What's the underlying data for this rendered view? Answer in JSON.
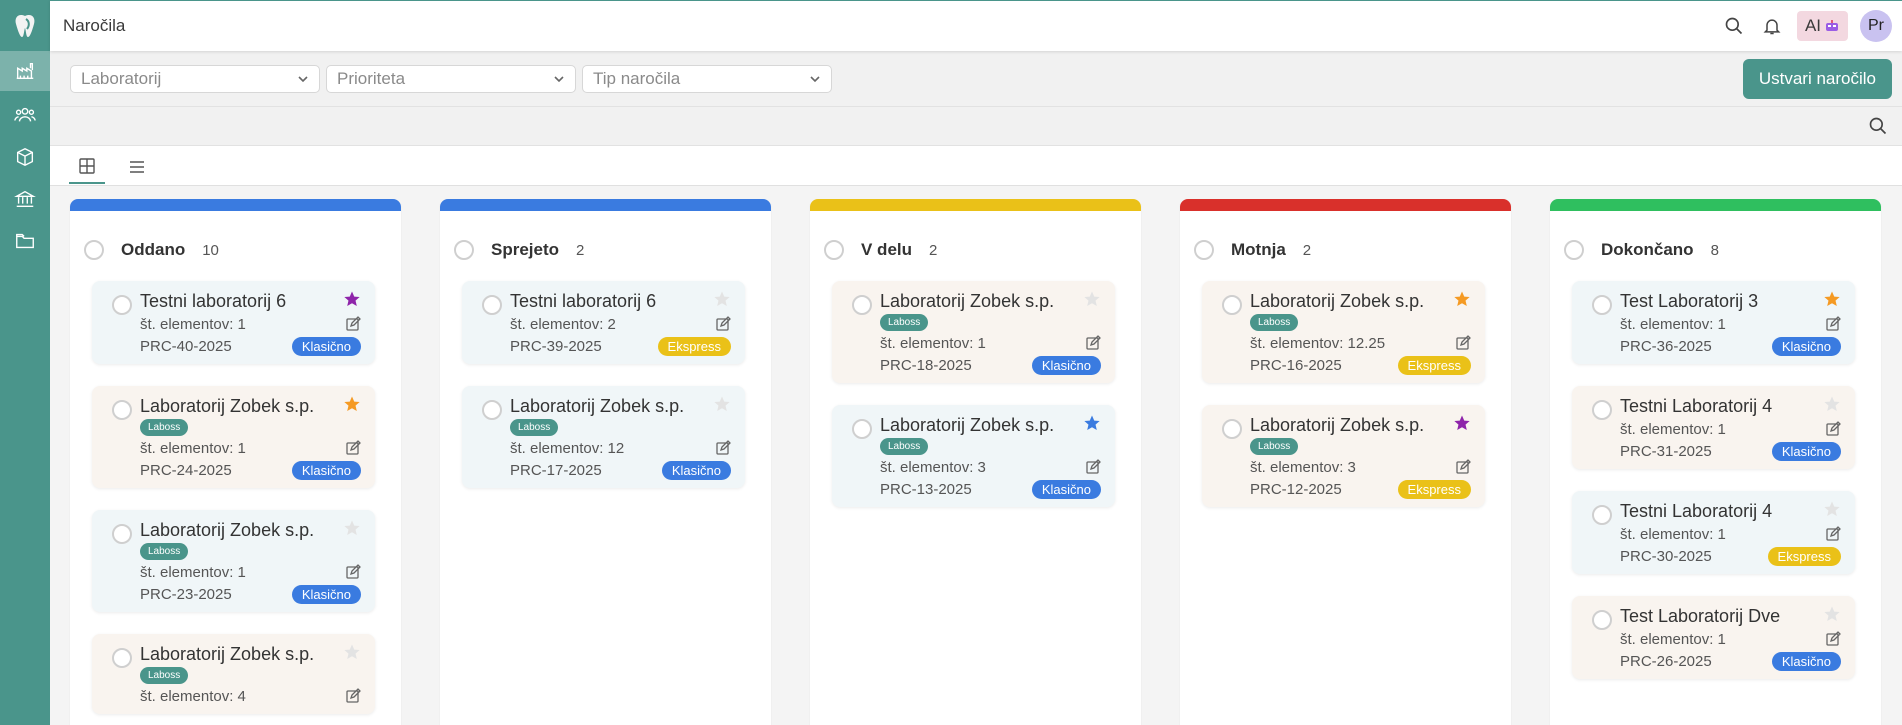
{
  "app": {
    "page_title": "Naročila",
    "ai_label": "AI",
    "avatar_initials": "Pr"
  },
  "filters": {
    "laboratory": "Laboratorij",
    "priority": "Prioriteta",
    "order_type": "Tip naročila",
    "create_label": "Ustvari naročilo"
  },
  "colors": {
    "accent": "#4a958b",
    "klasicno": "#3a7be0",
    "ekspress": "#eac118"
  },
  "columns": [
    {
      "title": "Oddano",
      "count": "10",
      "color": "#3a7be0",
      "cards": [
        {
          "title": "Testni laboratorij 6",
          "tag": "",
          "elements": "št. elementov: 1",
          "code": "PRC-40-2025",
          "type": "Klasično",
          "star": "purple",
          "bg": "blue"
        },
        {
          "title": "Laboratorij Zobek s.p.",
          "tag": "Laboss",
          "elements": "št. elementov: 1",
          "code": "PRC-24-2025",
          "type": "Klasično",
          "star": "orange",
          "bg": "beige"
        },
        {
          "title": "Laboratorij Zobek s.p.",
          "tag": "Laboss",
          "elements": "št. elementov: 1",
          "code": "PRC-23-2025",
          "type": "Klasično",
          "star": "grey",
          "bg": "blue"
        },
        {
          "title": "Laboratorij Zobek s.p.",
          "tag": "Laboss",
          "elements": "št. elementov: 4",
          "code": "",
          "type": "",
          "star": "grey",
          "bg": "beige"
        }
      ]
    },
    {
      "title": "Sprejeto",
      "count": "2",
      "color": "#3a7be0",
      "cards": [
        {
          "title": "Testni laboratorij 6",
          "tag": "",
          "elements": "št. elementov: 2",
          "code": "PRC-39-2025",
          "type": "Ekspress",
          "star": "grey",
          "bg": "blue"
        },
        {
          "title": "Laboratorij Zobek s.p.",
          "tag": "Laboss",
          "elements": "št. elementov: 12",
          "code": "PRC-17-2025",
          "type": "Klasično",
          "star": "grey",
          "bg": "blue"
        }
      ]
    },
    {
      "title": "V delu",
      "count": "2",
      "color": "#eac118",
      "cards": [
        {
          "title": "Laboratorij Zobek s.p.",
          "tag": "Laboss",
          "elements": "št. elementov: 1",
          "code": "PRC-18-2025",
          "type": "Klasično",
          "star": "grey",
          "bg": "beige"
        },
        {
          "title": "Laboratorij Zobek s.p.",
          "tag": "Laboss",
          "elements": "št. elementov: 3",
          "code": "PRC-13-2025",
          "type": "Klasično",
          "star": "blue",
          "bg": "blue"
        }
      ]
    },
    {
      "title": "Motnja",
      "count": "2",
      "color": "#d9302b",
      "cards": [
        {
          "title": "Laboratorij Zobek s.p.",
          "tag": "Laboss",
          "elements": "št. elementov: 12.25",
          "code": "PRC-16-2025",
          "type": "Ekspress",
          "star": "orange",
          "bg": "beige"
        },
        {
          "title": "Laboratorij Zobek s.p.",
          "tag": "Laboss",
          "elements": "št. elementov: 3",
          "code": "PRC-12-2025",
          "type": "Ekspress",
          "star": "purple",
          "bg": "beige"
        }
      ]
    },
    {
      "title": "Dokončano",
      "count": "8",
      "color": "#2fbf5f",
      "cards": [
        {
          "title": "Test Laboratorij 3",
          "tag": "",
          "elements": "št. elementov: 1",
          "code": "PRC-36-2025",
          "type": "Klasično",
          "star": "orange",
          "bg": "blue"
        },
        {
          "title": "Testni Laboratorij 4",
          "tag": "",
          "elements": "št. elementov: 1",
          "code": "PRC-31-2025",
          "type": "Klasično",
          "star": "grey",
          "bg": "beige"
        },
        {
          "title": "Testni Laboratorij 4",
          "tag": "",
          "elements": "št. elementov: 1",
          "code": "PRC-30-2025",
          "type": "Ekspress",
          "star": "grey",
          "bg": "blue"
        },
        {
          "title": "Test Laboratorij Dve",
          "tag": "",
          "elements": "št. elementov: 1",
          "code": "PRC-26-2025",
          "type": "Klasično",
          "star": "grey",
          "bg": "beige"
        }
      ]
    }
  ]
}
